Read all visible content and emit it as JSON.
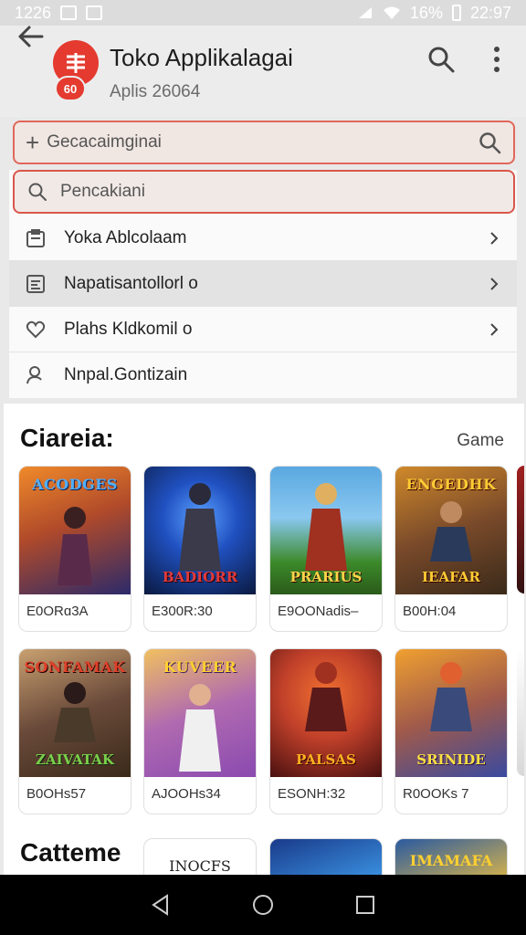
{
  "status_bar": {
    "time_left": "1226",
    "battery": "16%",
    "clock": "22:97"
  },
  "header": {
    "title": "Toko Applikalagai",
    "subtitle": "Aplis 26064",
    "logo_badge": "60",
    "back_icon": "arrow-left-icon",
    "search_icon": "search-icon",
    "more_icon": "more-vert-icon"
  },
  "search_bar": {
    "value": "Gecacaimginai",
    "prefix_icon": "plus-icon"
  },
  "dropdown": {
    "search_placeholder": "Pencakiani",
    "items": [
      {
        "label": "Yoka Ablcolaam",
        "icon": "clipboard-icon",
        "chevron": true
      },
      {
        "label": "Napatisantollorl o",
        "icon": "document-icon",
        "chevron": true
      },
      {
        "label": "Plahs Kldkomil o",
        "icon": "heart-icon",
        "chevron": true
      },
      {
        "label": "Nnpal.Gontizain",
        "icon": "user-icon",
        "chevron": false
      }
    ]
  },
  "section": {
    "title": "Ciareia:",
    "link": "Game",
    "second_title": "Cattеme",
    "row1": [
      {
        "label": "E0ORɑ3A",
        "thumb_title": "ACODGES",
        "thumb_bottom": "",
        "c1": "#f08a2a",
        "c2": "#2c2a6a",
        "title_color": "#4fb0ff"
      },
      {
        "label": "E300R:30",
        "thumb_title": "",
        "thumb_bottom": "BADIORR",
        "c1": "#2050c0",
        "c2": "#0a1a40",
        "title_color": "#e23a3a"
      },
      {
        "label": "E9OONadis–",
        "thumb_title": "",
        "thumb_bottom": "PRARIUS",
        "c1": "#5aa8e0",
        "c2": "#3c8a2a",
        "title_color": "#ffd54a"
      },
      {
        "label": "B00H:04",
        "thumb_title": "ENGEDHK",
        "thumb_bottom": "IEAFAR",
        "c1": "#d08a2a",
        "c2": "#3a2a1a",
        "title_color": "#ffcc33"
      }
    ],
    "row2": [
      {
        "label": "B0OHs57",
        "thumb_title": "SONFAMAK",
        "thumb_bottom": "ZAIVATAK",
        "c1": "#c8a070",
        "c2": "#3a2a1a",
        "title_color": "#e0402a"
      },
      {
        "label": "AJOOHs34",
        "thumb_title": "KUVEER",
        "thumb_bottom": "",
        "c1": "#8a4ab0",
        "c2": "#f0c060",
        "title_color": "#ffd030"
      },
      {
        "label": "ESONH:32",
        "thumb_title": "",
        "thumb_bottom": "PALSAS",
        "c1": "#c0402a",
        "c2": "#4a1010",
        "title_color": "#ffb020"
      },
      {
        "label": "R0OOKs 7",
        "thumb_title": "",
        "thumb_bottom": "SRINIDE",
        "c1": "#f0a030",
        "c2": "#3a4aa0",
        "title_color": "#ffe040"
      }
    ],
    "row3": [
      {
        "label": "INOCFS",
        "c1": "#ffffff",
        "c2": "#ffffff"
      },
      {
        "label": "",
        "c1": "#1a3a8a",
        "c2": "#40a0f0"
      },
      {
        "label": "IMAMAFA",
        "c1": "#2a5aa0",
        "c2": "#f0c040"
      }
    ]
  },
  "nav": {
    "back": "nav-back-icon",
    "home": "nav-home-icon",
    "recent": "nav-recents-icon"
  },
  "colors": {
    "accent": "#e43a2f",
    "search_border": "#d9574a",
    "page_bg": "#e9e9e9"
  }
}
